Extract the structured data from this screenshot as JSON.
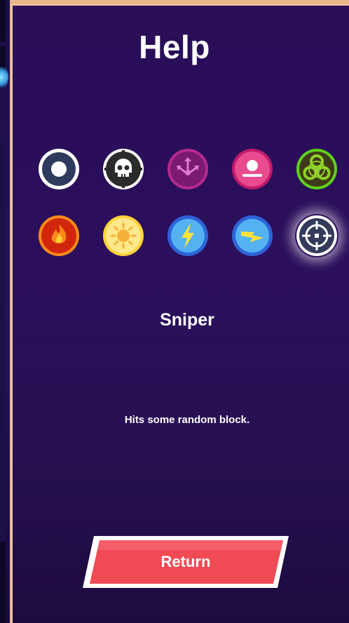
{
  "screen": {
    "title": "Help"
  },
  "powerups": [
    {
      "icon": "white-ball-icon",
      "ring": "#ffffff",
      "fill": "#2e3b5e"
    },
    {
      "icon": "skull-icon",
      "ring": "#ffffff",
      "fill": "#2b2b2b"
    },
    {
      "icon": "split-arrows-icon",
      "ring": "#b52a90",
      "fill": "#7a1a72"
    },
    {
      "icon": "ball-on-platform-icon",
      "ring": "#c21a6c",
      "fill": "#ea4a8e"
    },
    {
      "icon": "biohazard-icon",
      "ring": "#5fd11b",
      "fill": "#3f3a18"
    },
    {
      "icon": "fire-icon",
      "ring": "#ff8a1a",
      "fill": "#d2260c"
    },
    {
      "icon": "sun-icon",
      "ring": "#ffd23a",
      "fill": "#ffe88a"
    },
    {
      "icon": "lightning-vertical-icon",
      "ring": "#2e63d9",
      "fill": "#54b2f2"
    },
    {
      "icon": "lightning-horizontal-icon",
      "ring": "#2e63d9",
      "fill": "#54b2f2"
    },
    {
      "icon": "crosshair-icon",
      "ring": "#ffffff",
      "fill": "#343a5a"
    }
  ],
  "selected": {
    "name": "Sniper",
    "description": "Hits some random block."
  },
  "buttons": {
    "return_label": "Return"
  },
  "colors": {
    "panel_top": "#2a0e58",
    "panel_bottom": "#1d0b3e",
    "button_red": "#f04a55",
    "frame_orange": "#e8b48a"
  }
}
